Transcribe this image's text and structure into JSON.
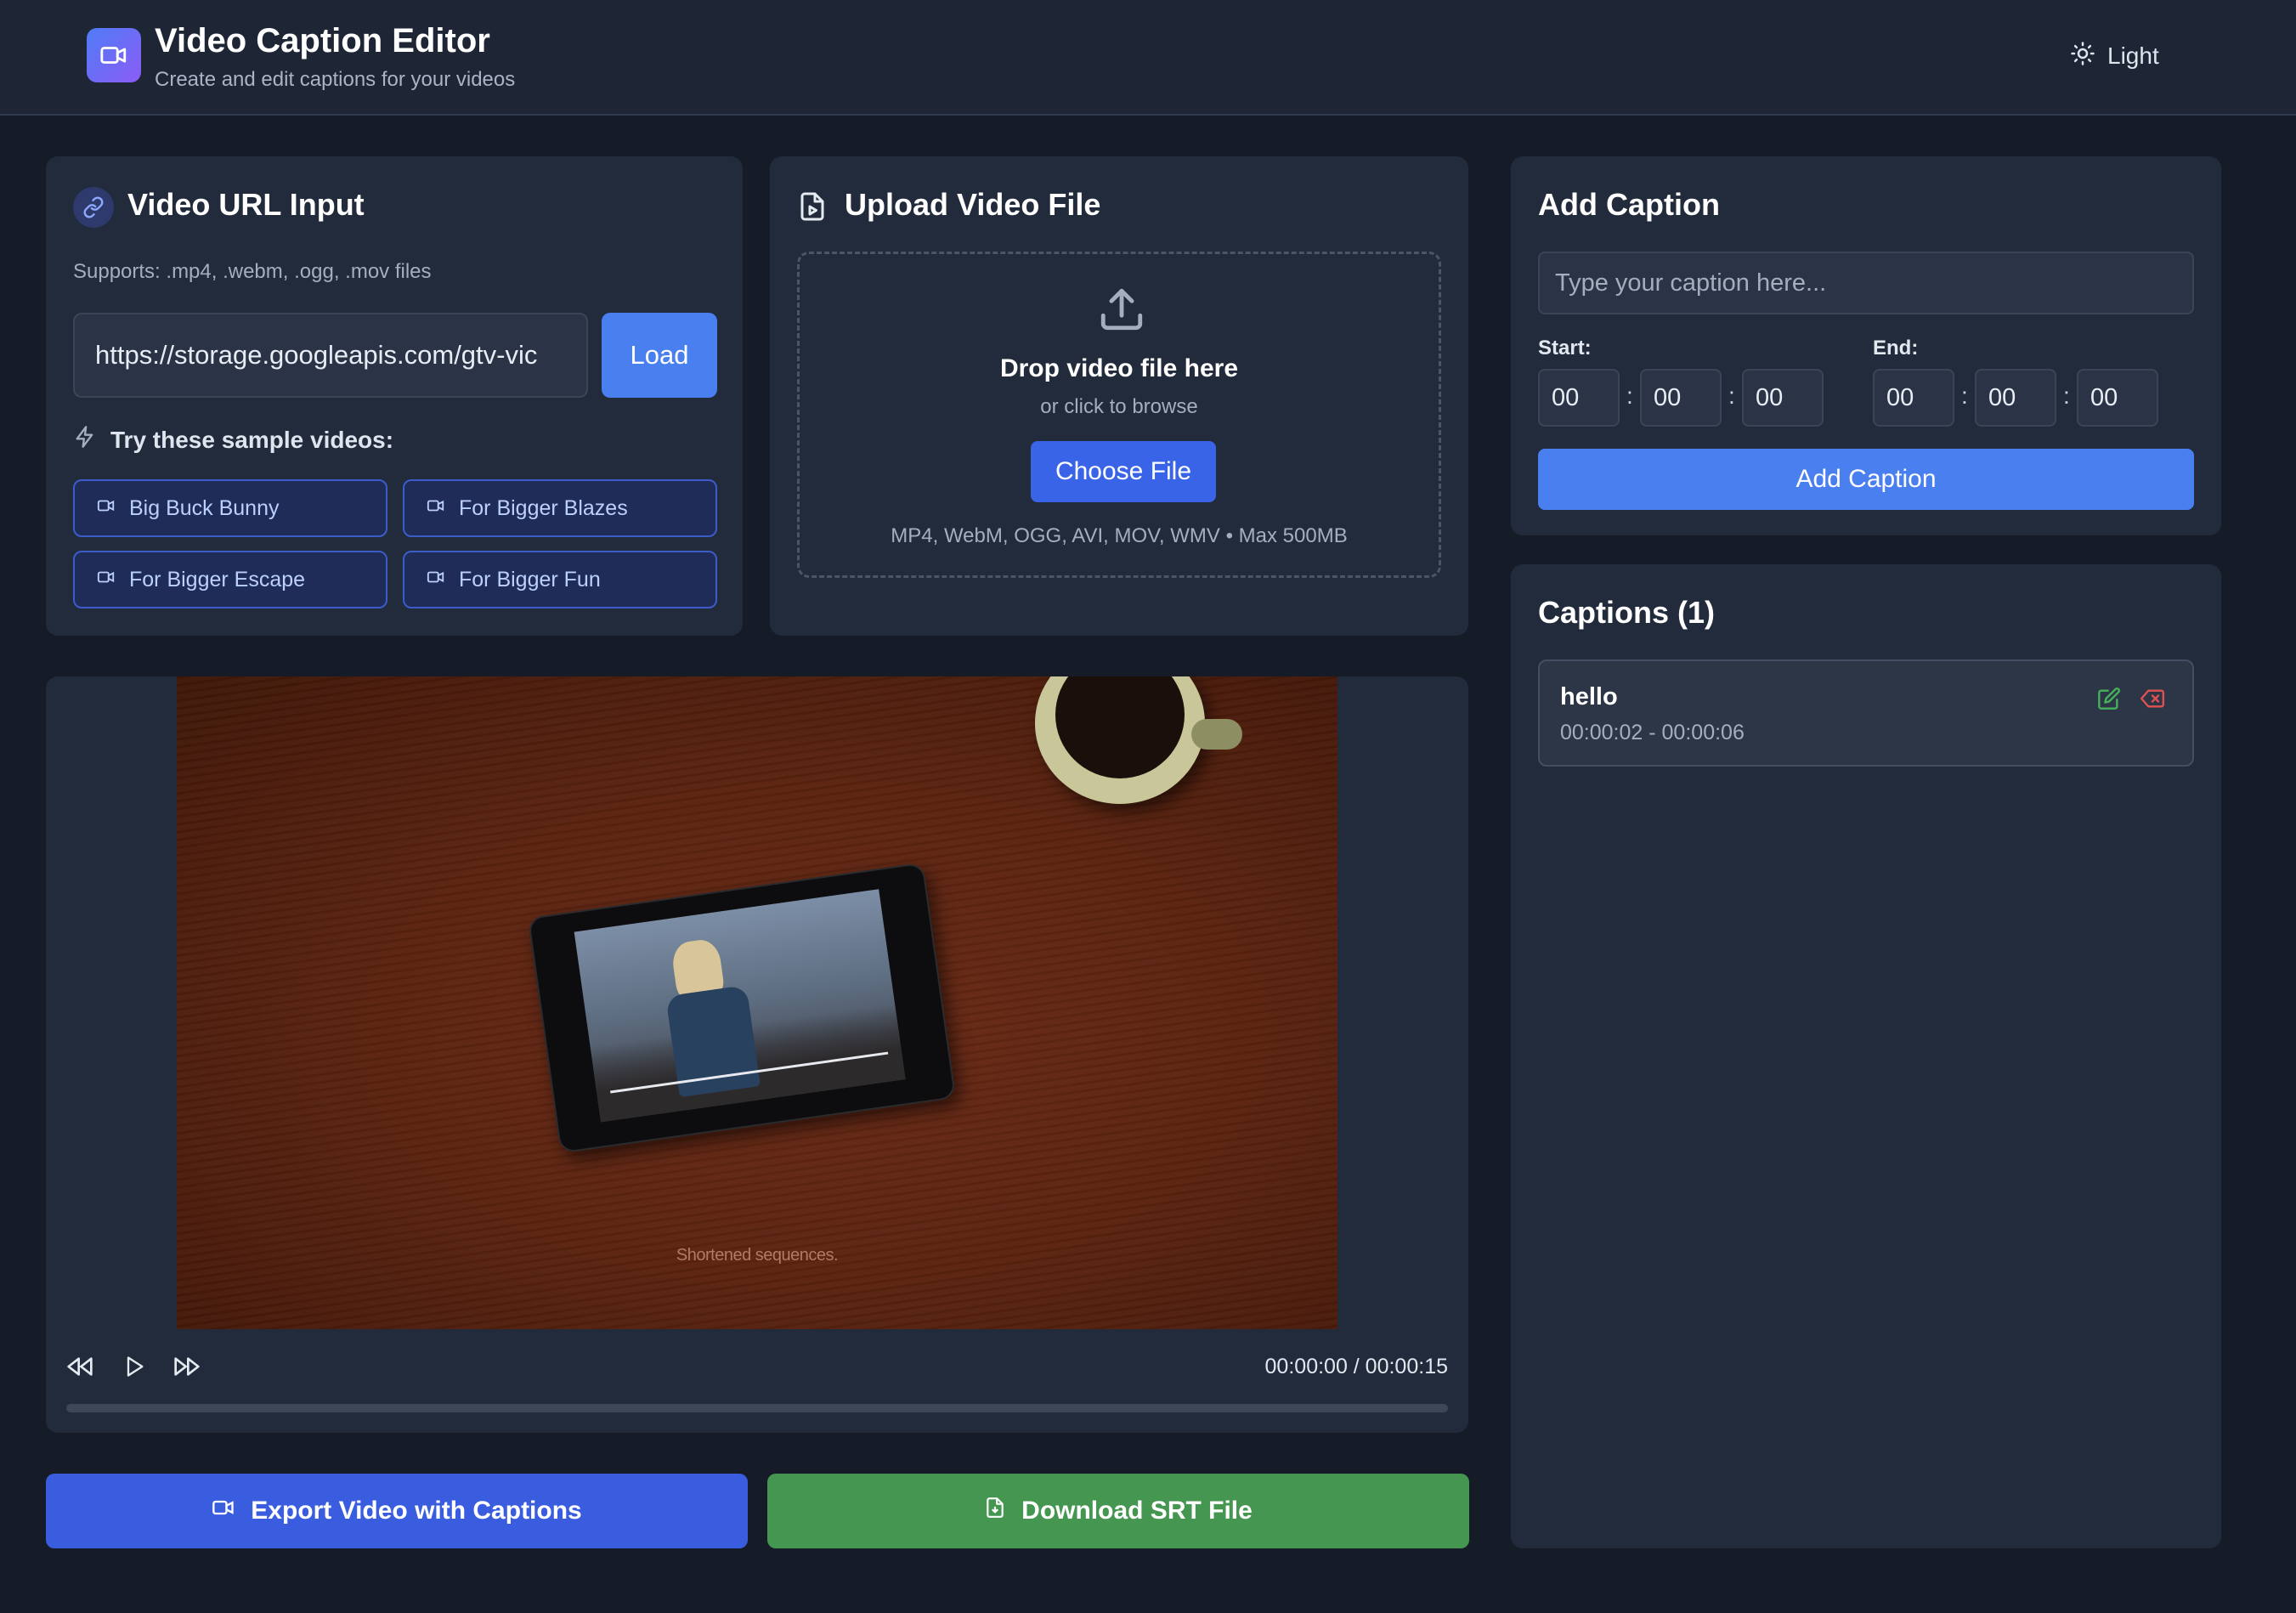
{
  "header": {
    "title": "Video Caption Editor",
    "subtitle": "Create and edit captions for your videos",
    "theme_label": "Light"
  },
  "url_panel": {
    "title": "Video URL Input",
    "supports": "Supports: .mp4, .webm, .ogg, .mov files",
    "url_value": "https://storage.googleapis.com/gtv-vic",
    "load_label": "Load",
    "samples_heading": "Try these sample videos:",
    "samples": [
      "Big Buck Bunny",
      "For Bigger Blazes",
      "For Bigger Escape",
      "For Bigger Fun"
    ]
  },
  "upload_panel": {
    "title": "Upload Video File",
    "drop_text": "Drop video file here",
    "browse_text": "or click to browse",
    "choose_label": "Choose File",
    "formats": "MP4, WebM, OGG, AVI, MOV, WMV • Max 500MB"
  },
  "add_caption": {
    "title": "Add Caption",
    "placeholder": "Type your caption here...",
    "start_label": "Start:",
    "end_label": "End:",
    "start": [
      "00",
      "00",
      "00"
    ],
    "end": [
      "00",
      "00",
      "00"
    ],
    "colon": ":",
    "button_label": "Add Caption"
  },
  "captions": {
    "title": "Captions (1)",
    "items": [
      {
        "text": "hello",
        "range": "00:00:02 - 00:00:06"
      }
    ]
  },
  "player": {
    "overlay_text": "Shortened sequences.",
    "time": "00:00:00 / 00:00:15",
    "progress": 0
  },
  "actions": {
    "export_label": "Export Video with Captions",
    "srt_label": "Download SRT File"
  },
  "colors": {
    "background": "#151b27",
    "card": "#222b3b",
    "primary": "#4a7ff0",
    "success": "#459650",
    "danger": "#e05252"
  }
}
